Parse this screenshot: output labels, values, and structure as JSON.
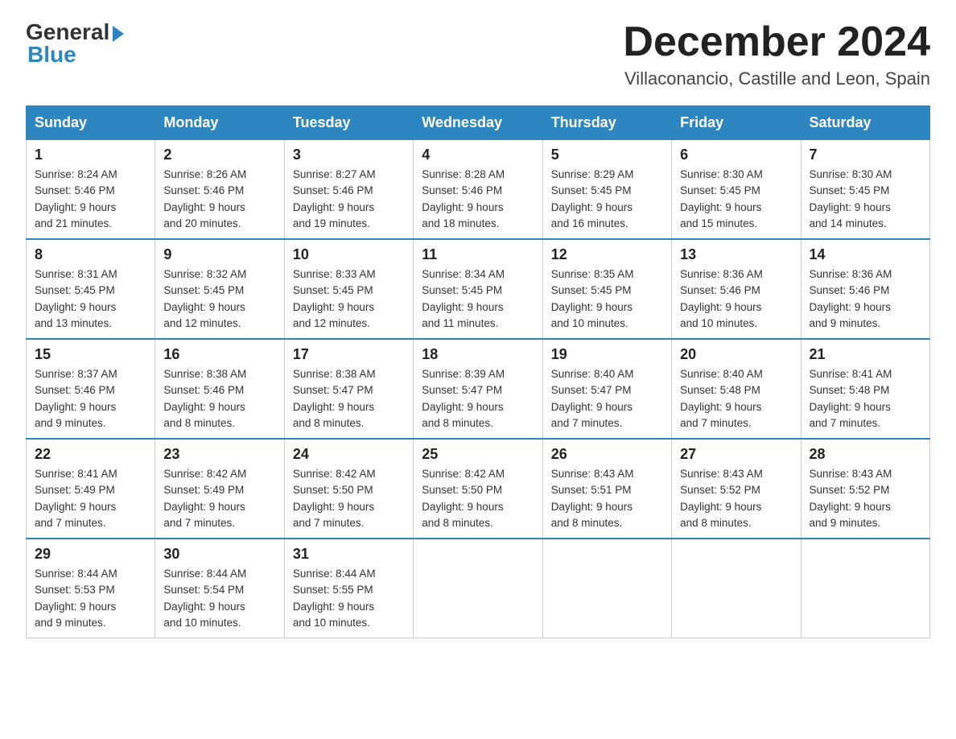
{
  "header": {
    "logo_general": "General",
    "logo_blue": "Blue",
    "month_title": "December 2024",
    "location": "Villaconancio, Castille and Leon, Spain"
  },
  "days_of_week": [
    "Sunday",
    "Monday",
    "Tuesday",
    "Wednesday",
    "Thursday",
    "Friday",
    "Saturday"
  ],
  "weeks": [
    [
      {
        "day": "1",
        "sunrise": "8:24 AM",
        "sunset": "5:46 PM",
        "daylight": "9 hours and 21 minutes."
      },
      {
        "day": "2",
        "sunrise": "8:26 AM",
        "sunset": "5:46 PM",
        "daylight": "9 hours and 20 minutes."
      },
      {
        "day": "3",
        "sunrise": "8:27 AM",
        "sunset": "5:46 PM",
        "daylight": "9 hours and 19 minutes."
      },
      {
        "day": "4",
        "sunrise": "8:28 AM",
        "sunset": "5:46 PM",
        "daylight": "9 hours and 18 minutes."
      },
      {
        "day": "5",
        "sunrise": "8:29 AM",
        "sunset": "5:45 PM",
        "daylight": "9 hours and 16 minutes."
      },
      {
        "day": "6",
        "sunrise": "8:30 AM",
        "sunset": "5:45 PM",
        "daylight": "9 hours and 15 minutes."
      },
      {
        "day": "7",
        "sunrise": "8:30 AM",
        "sunset": "5:45 PM",
        "daylight": "9 hours and 14 minutes."
      }
    ],
    [
      {
        "day": "8",
        "sunrise": "8:31 AM",
        "sunset": "5:45 PM",
        "daylight": "9 hours and 13 minutes."
      },
      {
        "day": "9",
        "sunrise": "8:32 AM",
        "sunset": "5:45 PM",
        "daylight": "9 hours and 12 minutes."
      },
      {
        "day": "10",
        "sunrise": "8:33 AM",
        "sunset": "5:45 PM",
        "daylight": "9 hours and 12 minutes."
      },
      {
        "day": "11",
        "sunrise": "8:34 AM",
        "sunset": "5:45 PM",
        "daylight": "9 hours and 11 minutes."
      },
      {
        "day": "12",
        "sunrise": "8:35 AM",
        "sunset": "5:45 PM",
        "daylight": "9 hours and 10 minutes."
      },
      {
        "day": "13",
        "sunrise": "8:36 AM",
        "sunset": "5:46 PM",
        "daylight": "9 hours and 10 minutes."
      },
      {
        "day": "14",
        "sunrise": "8:36 AM",
        "sunset": "5:46 PM",
        "daylight": "9 hours and 9 minutes."
      }
    ],
    [
      {
        "day": "15",
        "sunrise": "8:37 AM",
        "sunset": "5:46 PM",
        "daylight": "9 hours and 9 minutes."
      },
      {
        "day": "16",
        "sunrise": "8:38 AM",
        "sunset": "5:46 PM",
        "daylight": "9 hours and 8 minutes."
      },
      {
        "day": "17",
        "sunrise": "8:38 AM",
        "sunset": "5:47 PM",
        "daylight": "9 hours and 8 minutes."
      },
      {
        "day": "18",
        "sunrise": "8:39 AM",
        "sunset": "5:47 PM",
        "daylight": "9 hours and 8 minutes."
      },
      {
        "day": "19",
        "sunrise": "8:40 AM",
        "sunset": "5:47 PM",
        "daylight": "9 hours and 7 minutes."
      },
      {
        "day": "20",
        "sunrise": "8:40 AM",
        "sunset": "5:48 PM",
        "daylight": "9 hours and 7 minutes."
      },
      {
        "day": "21",
        "sunrise": "8:41 AM",
        "sunset": "5:48 PM",
        "daylight": "9 hours and 7 minutes."
      }
    ],
    [
      {
        "day": "22",
        "sunrise": "8:41 AM",
        "sunset": "5:49 PM",
        "daylight": "9 hours and 7 minutes."
      },
      {
        "day": "23",
        "sunrise": "8:42 AM",
        "sunset": "5:49 PM",
        "daylight": "9 hours and 7 minutes."
      },
      {
        "day": "24",
        "sunrise": "8:42 AM",
        "sunset": "5:50 PM",
        "daylight": "9 hours and 7 minutes."
      },
      {
        "day": "25",
        "sunrise": "8:42 AM",
        "sunset": "5:50 PM",
        "daylight": "9 hours and 8 minutes."
      },
      {
        "day": "26",
        "sunrise": "8:43 AM",
        "sunset": "5:51 PM",
        "daylight": "9 hours and 8 minutes."
      },
      {
        "day": "27",
        "sunrise": "8:43 AM",
        "sunset": "5:52 PM",
        "daylight": "9 hours and 8 minutes."
      },
      {
        "day": "28",
        "sunrise": "8:43 AM",
        "sunset": "5:52 PM",
        "daylight": "9 hours and 9 minutes."
      }
    ],
    [
      {
        "day": "29",
        "sunrise": "8:44 AM",
        "sunset": "5:53 PM",
        "daylight": "9 hours and 9 minutes."
      },
      {
        "day": "30",
        "sunrise": "8:44 AM",
        "sunset": "5:54 PM",
        "daylight": "9 hours and 10 minutes."
      },
      {
        "day": "31",
        "sunrise": "8:44 AM",
        "sunset": "5:55 PM",
        "daylight": "9 hours and 10 minutes."
      },
      null,
      null,
      null,
      null
    ]
  ],
  "labels": {
    "sunrise": "Sunrise:",
    "sunset": "Sunset:",
    "daylight": "Daylight:"
  }
}
